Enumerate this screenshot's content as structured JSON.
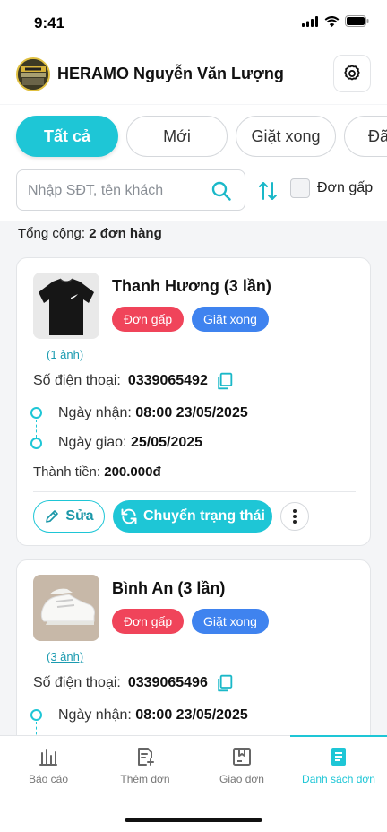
{
  "status_bar": {
    "time": "9:41"
  },
  "header": {
    "shop_name": "HERAMO Nguyễn Văn Lượng",
    "avatar_icon": "shop-logo",
    "settings_icon": "gear-icon"
  },
  "tabs": [
    {
      "label": "Tất cả",
      "active": true
    },
    {
      "label": "Mới",
      "active": false
    },
    {
      "label": "Giặt xong",
      "active": false
    },
    {
      "label": "Đã",
      "active": false
    }
  ],
  "toolbar": {
    "search_placeholder": "Nhập SĐT, tên khách",
    "search_icon": "search-icon",
    "sort_icon": "sort-icon",
    "urgent_label": "Đơn gấp",
    "urgent_checked": false
  },
  "summary": {
    "label": "Tổng cộng:",
    "value": "2 đơn hàng"
  },
  "orders": [
    {
      "customer": "Thanh Hương (3 lần)",
      "badges": [
        "Đơn gấp",
        "Giặt xong"
      ],
      "image_count": "(1 ảnh)",
      "phone_label": "Số điện thoại:",
      "phone": "0339065492",
      "received_label": "Ngày nhận:",
      "received": "08:00 23/05/2025",
      "delivery_label": "Ngày giao:",
      "delivery": "25/05/2025",
      "total_label": "Thành tiền:",
      "total": "200.000đ",
      "edit_label": "Sửa",
      "status_label": "Chuyển trạng thái"
    },
    {
      "customer": "Bình An (3 lần)",
      "badges": [
        "Đơn gấp",
        "Giặt xong"
      ],
      "image_count": "(3 ảnh)",
      "phone_label": "Số điện thoại:",
      "phone": "0339065496",
      "received_label": "Ngày nhận:",
      "received": "08:00 23/05/2025"
    }
  ],
  "bottom_nav": [
    {
      "label": "Báo cáo",
      "icon": "report-chart-icon",
      "active": false
    },
    {
      "label": "Thêm đơn",
      "icon": "add-order-icon",
      "active": false
    },
    {
      "label": "Giao đơn",
      "icon": "delivery-box-icon",
      "active": false
    },
    {
      "label": "Danh sách đơn",
      "icon": "order-list-icon",
      "active": true
    }
  ],
  "colors": {
    "accent": "#1ec6d6",
    "urgent": "#f0445a",
    "washed": "#3f83ef"
  }
}
